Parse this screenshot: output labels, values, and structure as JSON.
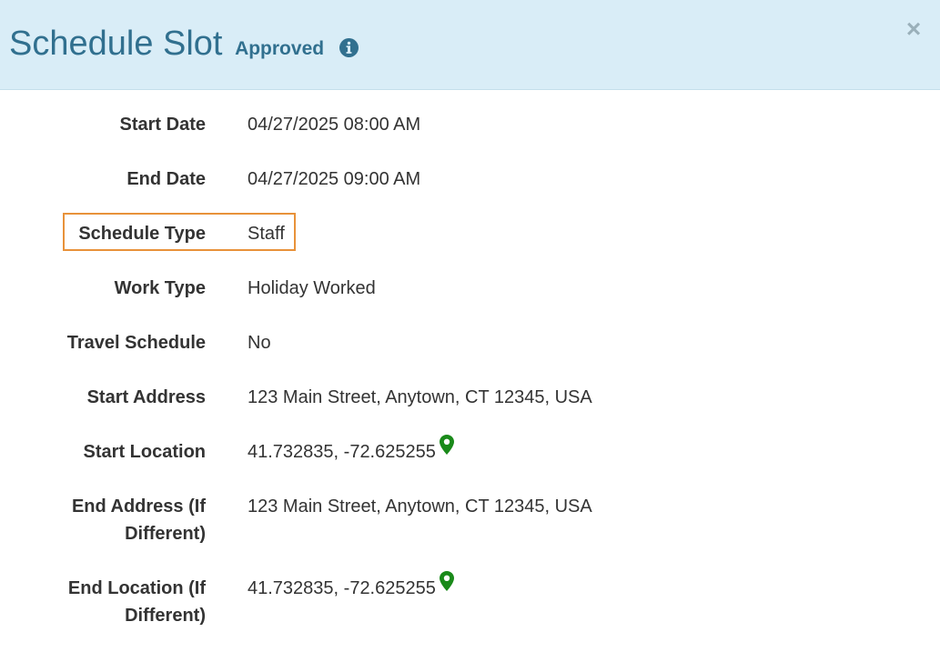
{
  "header": {
    "title": "Schedule Slot",
    "status": "Approved",
    "info_icon": "info-circle-icon",
    "close_label": "×"
  },
  "fields": [
    {
      "label": "Start Date",
      "value": "04/27/2025 08:00 AM"
    },
    {
      "label": "End Date",
      "value": "04/27/2025 09:00 AM"
    },
    {
      "label": "Schedule Type",
      "value": "Staff"
    },
    {
      "label": "Work Type",
      "value": "Holiday Worked"
    },
    {
      "label": "Travel Schedule",
      "value": "No"
    },
    {
      "label": "Start Address",
      "value": "123 Main Street, Anytown, CT 12345, USA"
    },
    {
      "label": "Start Location",
      "value": "41.732835, -72.625255",
      "icon": "map-marker-icon"
    },
    {
      "label_line1": "End Address (If",
      "label_line2": "Different)",
      "value": "123 Main Street, Anytown, CT 12345, USA"
    },
    {
      "label_line1": "End Location (If",
      "label_line2": "Different)",
      "value": "41.732835, -72.625255",
      "icon": "map-marker-icon"
    }
  ],
  "colors": {
    "header_bg": "#d9edf7",
    "title": "#31708f",
    "highlight_border": "#e8923a",
    "map_marker": "#1a8a1a"
  }
}
